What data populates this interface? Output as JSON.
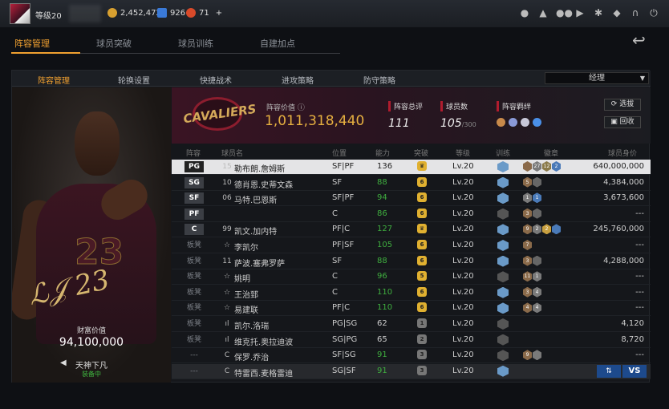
{
  "topbar": {
    "level": "等级20",
    "gold": "2,452,472",
    "diamonds": "926",
    "tickets": "71",
    "add": "+",
    "icons": [
      "user-icon",
      "bell-icon",
      "friends-icon",
      "video-icon",
      "settings-icon",
      "shield-icon",
      "headset-icon",
      "power-icon"
    ]
  },
  "main_tabs": [
    "阵容管理",
    "球员突破",
    "球员训练",
    "自建加点"
  ],
  "sub_tabs": [
    "阵容管理",
    "轮换设置",
    "快捷战术",
    "进攻策略",
    "防守策略"
  ],
  "manager_select": "经理",
  "player_card": {
    "value_label": "财富价值",
    "value": "94,100,000",
    "tier": "天神下凡",
    "tier_status": "装备中",
    "signature": "",
    "jersey": "23"
  },
  "team_info": {
    "logo_text": "CAVALIERS",
    "roster_value_label": "阵容价值",
    "roster_value": "1,011,318,440",
    "rating_label": "阵容总评",
    "rating": "111",
    "count_label": "球员数",
    "count": "105",
    "count_max": "/300",
    "chem_label": "阵容羁绊",
    "chem_colors": [
      "#c88a4a",
      "#8a9ad8",
      "#c8c8d8",
      "#4a90e8"
    ],
    "btn_select": "选拔",
    "btn_recycle": "回收"
  },
  "columns": [
    "阵容",
    "球员名",
    "位置",
    "能力",
    "突破",
    "等级",
    "训练",
    "徽章",
    "球员身价"
  ],
  "rows": [
    {
      "slot": "PG",
      "type": "starter",
      "icon": "15",
      "name": "勒布朗.詹姆斯",
      "pos": "SF|PF",
      "ability": "136",
      "green": false,
      "tp": "crown",
      "lvl": "Lv.20",
      "train": "#6a9ac8",
      "hexes": [
        "#8a6a4a",
        "#7a7a7a",
        "#8a7a4a",
        "#4a7ab8"
      ],
      "hex_text": [
        "",
        "27",
        "12",
        "2"
      ],
      "price": "640,000,000",
      "sel": true
    },
    {
      "slot": "SG",
      "type": "starter",
      "icon": "10",
      "name": "德肖恩.史蒂文森",
      "pos": "SF",
      "ability": "88",
      "green": true,
      "tp": "6",
      "lvl": "Lv.20",
      "train": "#6a9ac8",
      "hexes": [
        "#8a6a4a",
        "#666"
      ],
      "hex_text": [
        "5",
        ""
      ],
      "price": "4,384,000"
    },
    {
      "slot": "SF",
      "type": "starter",
      "icon": "06",
      "name": "马特.巴恩斯",
      "pos": "SF|PF",
      "ability": "94",
      "green": true,
      "tp": "6",
      "lvl": "Lv.20",
      "train": "#6a9ac8",
      "hexes": [
        "#7a7a7a",
        "#4a7ab8"
      ],
      "hex_text": [
        "1",
        "1"
      ],
      "price": "3,673,600"
    },
    {
      "slot": "PF",
      "type": "starter",
      "icon": "",
      "name": "",
      "pos": "C",
      "ability": "86",
      "green": true,
      "tp": "6",
      "lvl": "Lv.20",
      "train": "#555",
      "hexes": [
        "#8a6a4a",
        "#666"
      ],
      "hex_text": [
        "3",
        ""
      ],
      "price": "---"
    },
    {
      "slot": "C",
      "type": "starter",
      "icon": "99",
      "name": "凯文.加内特",
      "pos": "PF|C",
      "ability": "127",
      "green": true,
      "tp": "crown",
      "lvl": "Lv.20",
      "train": "#6a9ac8",
      "hexes": [
        "#8a6a4a",
        "#7a7a7a",
        "#c8a040",
        "#4a7ab8"
      ],
      "hex_text": [
        "9",
        "2",
        "2",
        ""
      ],
      "price": "245,760,000"
    },
    {
      "slot": "板凳",
      "type": "bench",
      "icon": "☆",
      "name": "李凯尔",
      "pos": "PF|SF",
      "ability": "105",
      "green": true,
      "tp": "6",
      "lvl": "Lv.20",
      "train": "#6a9ac8",
      "hexes": [
        "#8a6a4a"
      ],
      "hex_text": [
        "7"
      ],
      "price": "---"
    },
    {
      "slot": "板凳",
      "type": "bench",
      "icon": "11",
      "name": "萨波.塞弗罗萨",
      "pos": "SF",
      "ability": "88",
      "green": true,
      "tp": "6",
      "lvl": "Lv.20",
      "train": "#6a9ac8",
      "hexes": [
        "#8a6a4a",
        "#666"
      ],
      "hex_text": [
        "3",
        ""
      ],
      "price": "4,288,000"
    },
    {
      "slot": "板凳",
      "type": "bench",
      "icon": "☆",
      "name": "姚明",
      "pos": "C",
      "ability": "96",
      "green": true,
      "tp": "5",
      "lvl": "Lv.20",
      "train": "#555",
      "hexes": [
        "#8a6a4a",
        "#7a7a7a"
      ],
      "hex_text": [
        "11",
        "1"
      ],
      "price": "---"
    },
    {
      "slot": "板凳",
      "type": "bench",
      "icon": "☆",
      "name": "王治郅",
      "pos": "C",
      "ability": "110",
      "green": true,
      "tp": "6",
      "lvl": "Lv.20",
      "train": "#6a9ac8",
      "hexes": [
        "#8a6a4a",
        "#7a7a7a"
      ],
      "hex_text": [
        "3",
        "4"
      ],
      "price": "---"
    },
    {
      "slot": "板凳",
      "type": "bench",
      "icon": "☆",
      "name": "易建联",
      "pos": "PF|C",
      "ability": "110",
      "green": true,
      "tp": "6",
      "lvl": "Lv.20",
      "train": "#6a9ac8",
      "hexes": [
        "#8a6a4a",
        "#7a7a7a"
      ],
      "hex_text": [
        "4",
        "4"
      ],
      "price": "---"
    },
    {
      "slot": "板凳",
      "type": "bench",
      "icon": "ıl",
      "name": "凯尔.洛瑞",
      "pos": "PG|SG",
      "ability": "62",
      "green": false,
      "tp": "1",
      "lvl": "Lv.20",
      "train": "#555",
      "hexes": [],
      "hex_text": [],
      "price": "4,120"
    },
    {
      "slot": "板凳",
      "type": "bench",
      "icon": "ıl",
      "name": "维克托.奥拉迪波",
      "pos": "SG|PG",
      "ability": "65",
      "green": false,
      "tp": "2",
      "lvl": "Lv.20",
      "train": "#555",
      "hexes": [],
      "hex_text": [],
      "price": "8,720"
    },
    {
      "slot": "---",
      "type": "bench",
      "icon": "C",
      "name": "保罗.乔治",
      "pos": "SF|SG",
      "ability": "91",
      "green": true,
      "tp": "3",
      "lvl": "Lv.20",
      "train": "#555",
      "hexes": [
        "#8a6a4a",
        "#7a7a7a"
      ],
      "hex_text": [
        "9",
        ""
      ],
      "price": "---"
    },
    {
      "slot": "---",
      "type": "bench",
      "icon": "C",
      "name": "特雷西.麦格雷迪",
      "pos": "SG|SF",
      "ability": "91",
      "green": true,
      "tp": "3",
      "lvl": "Lv.20",
      "train": "#6a9ac8",
      "hexes": [],
      "hex_text": [],
      "price": "",
      "last": true
    }
  ],
  "last_row_buttons": {
    "swap": "⇅",
    "vs": "VS"
  }
}
